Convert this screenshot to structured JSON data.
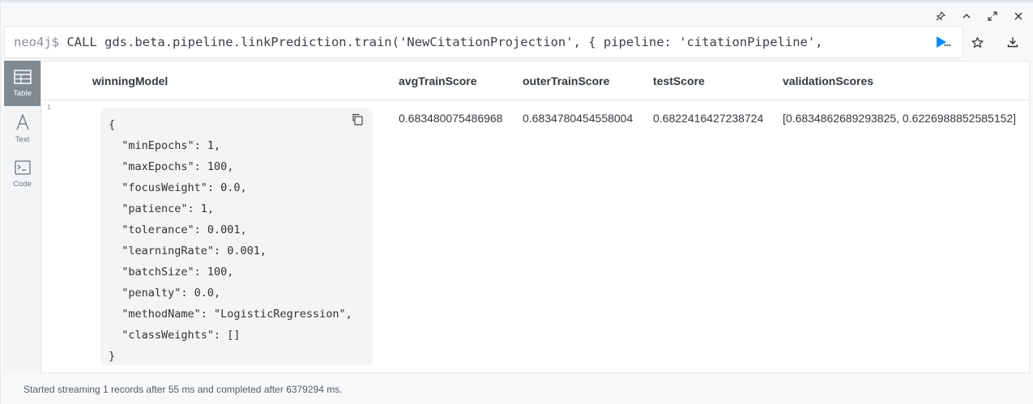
{
  "window_controls": {
    "icons": [
      "pin-icon",
      "collapse-icon",
      "expand-icon",
      "close-icon"
    ]
  },
  "editor": {
    "prompt": "neo4j$",
    "query": "CALL gds.beta.pipeline.linkPrediction.train('NewCitationProjection', { pipeline: 'citationPipeline',",
    "ellipsis": "…",
    "accent_color": "#018bff"
  },
  "rail": {
    "items": [
      {
        "label": "Table",
        "icon": "table-icon",
        "active": true
      },
      {
        "label": "Text",
        "icon": "text-icon",
        "active": false
      },
      {
        "label": "Code",
        "icon": "code-icon",
        "active": false
      }
    ]
  },
  "table": {
    "columns": [
      "winningModel",
      "avgTrainScore",
      "outerTrainScore",
      "testScore",
      "validationScores"
    ],
    "rows": [
      {
        "index": "1",
        "winningModel": [
          "{",
          "  \"minEpochs\": 1,",
          "  \"maxEpochs\": 100,",
          "  \"focusWeight\": 0.0,",
          "  \"patience\": 1,",
          "  \"tolerance\": 0.001,",
          "  \"learningRate\": 0.001,",
          "  \"batchSize\": 100,",
          "  \"penalty\": 0.0,",
          "  \"methodName\": \"LogisticRegression\",",
          "  \"classWeights\": []",
          "}"
        ],
        "avgTrainScore": "0.683480075486968",
        "outerTrainScore": "0.6834780454558004",
        "testScore": "0.6822416427238724",
        "validationScores": "[0.6834862689293825, 0.6226988852585152]"
      }
    ]
  },
  "status": {
    "text": "Started streaming 1 records after 55 ms and completed after 6379294 ms."
  }
}
